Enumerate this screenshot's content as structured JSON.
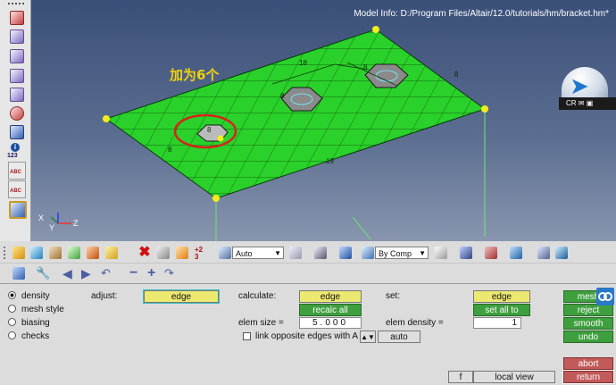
{
  "viewport": {
    "model_info": "Model Info: D:/Program Files/Altair/12.0/tutorials/hm/bracket.hm*",
    "annotation": "加为6个",
    "mesh_labels": [
      "18",
      "8",
      "8",
      "8",
      "8",
      "19",
      "8"
    ],
    "axis": {
      "x": "X",
      "y": "Y",
      "z": "Z"
    },
    "logo_text": "CR"
  },
  "left_toolbar": {
    "label_123": "123",
    "label_abc1": "ABC",
    "label_abc2": "ABC"
  },
  "toolbar": {
    "display_mode": "Auto",
    "color_mode": "By Comp",
    "plus_label": "+2",
    "plus_sub": "3"
  },
  "panel": {
    "radios": [
      {
        "label": "density",
        "selected": true
      },
      {
        "label": "mesh style",
        "selected": false
      },
      {
        "label": "biasing",
        "selected": false
      },
      {
        "label": "checks",
        "selected": false
      }
    ],
    "adjust_label": "adjust:",
    "adjust_button": "edge",
    "calculate_label": "calculate:",
    "calculate_button": "edge",
    "recalc_button": "recalc all",
    "elem_size_label": "elem size =",
    "elem_size_value": "5.000",
    "link_label": "link opposite edges with A",
    "auto_button": "auto",
    "set_label": "set:",
    "set_button": "edge",
    "set_all_button": "set all to",
    "elem_density_label": "elem density =",
    "elem_density_value": "1",
    "f_button": "f",
    "local_view_button": "local view",
    "mesh_button": "mesh",
    "reject_button": "reject",
    "smooth_button": "smooth",
    "undo_button": "undo",
    "abort_button": "abort",
    "return_button": "return"
  }
}
